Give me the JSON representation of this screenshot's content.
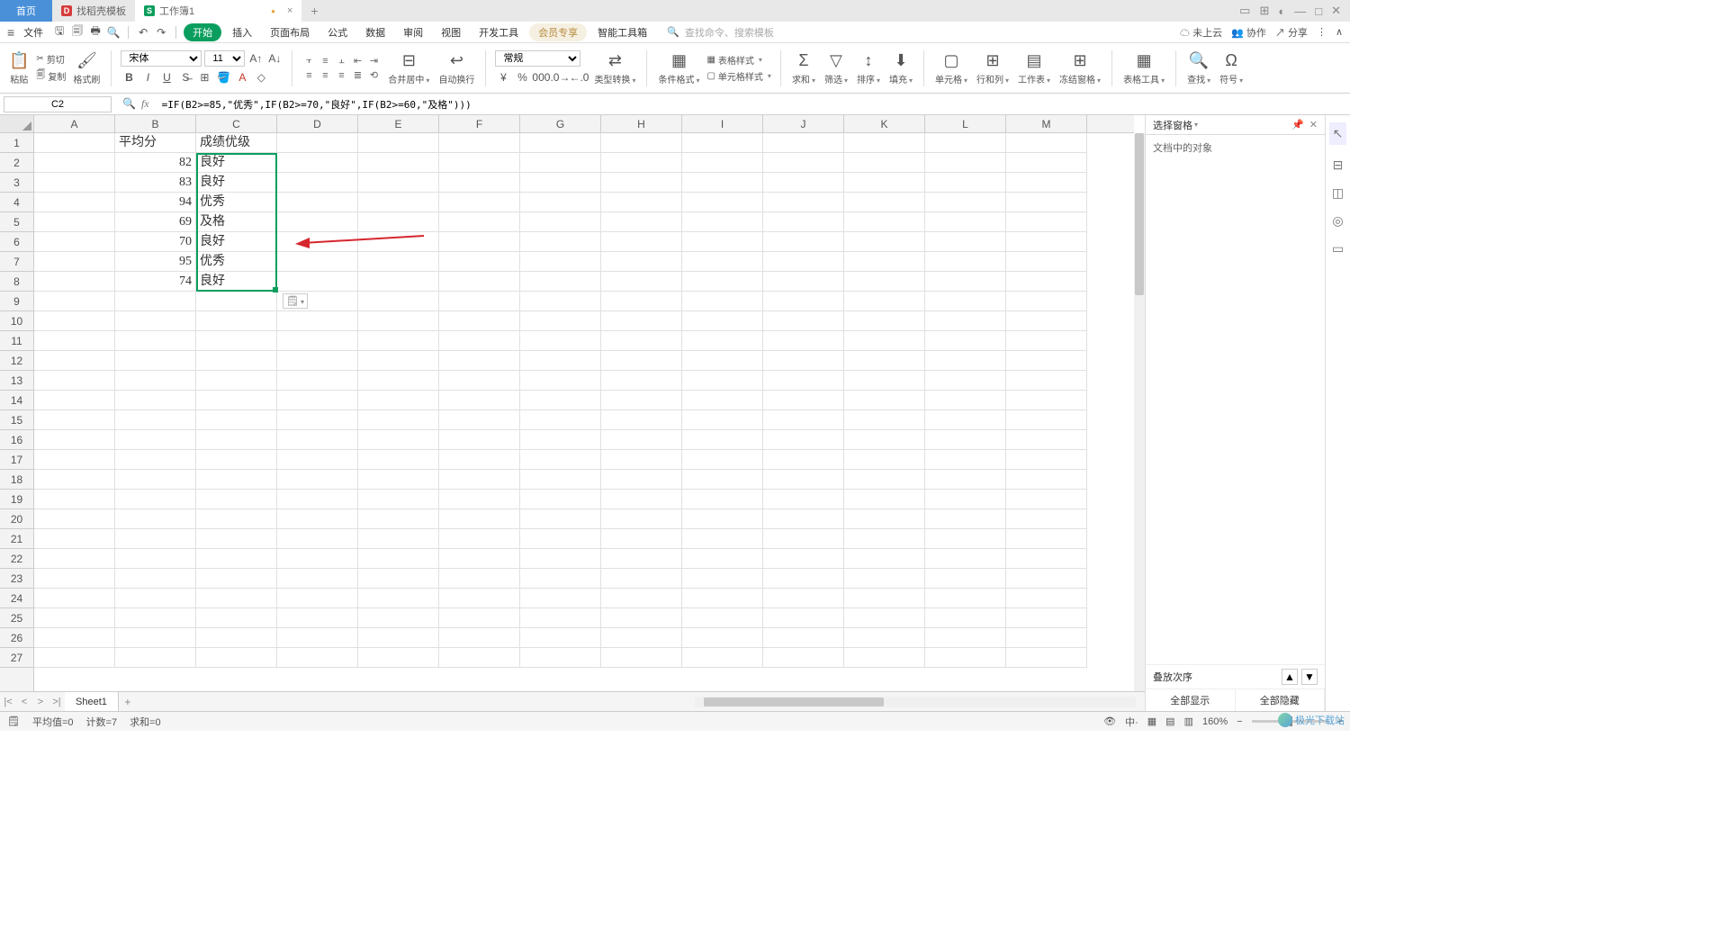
{
  "titlebar": {
    "home": "首页",
    "tab2": "找稻壳模板",
    "tab3": "工作簿1"
  },
  "menubar": {
    "file": "文件",
    "tabs": [
      "开始",
      "插入",
      "页面布局",
      "公式",
      "数据",
      "审阅",
      "视图",
      "开发工具",
      "会员专享",
      "智能工具箱"
    ],
    "search_hint": "查找命令、搜索模板",
    "cloud": "未上云",
    "coop": "协作",
    "share": "分享"
  },
  "ribbon": {
    "paste": "粘贴",
    "cut": "剪切",
    "copy": "复制",
    "fmtpainter": "格式刷",
    "font_name": "宋体",
    "font_size": "11",
    "merge": "合并居中",
    "wrap": "自动换行",
    "num_fmt": "常规",
    "type_conv": "类型转换",
    "cond_fmt": "条件格式",
    "table_style": "表格样式",
    "cell_style": "单元格样式",
    "sum": "求和",
    "filter": "筛选",
    "sort": "排序",
    "fill": "填充",
    "cell": "单元格",
    "rowcol": "行和列",
    "wksheet": "工作表",
    "freeze": "冻结窗格",
    "tools": "表格工具",
    "find": "查找",
    "symbol": "符号"
  },
  "formula": {
    "cell_ref": "C2",
    "text": "=IF(B2>=85,\"优秀\",IF(B2>=70,\"良好\",IF(B2>=60,\"及格\")))"
  },
  "columns": [
    "A",
    "B",
    "C",
    "D",
    "E",
    "F",
    "G",
    "H",
    "I",
    "J",
    "K",
    "L",
    "M"
  ],
  "rows": 27,
  "data": {
    "B1": "平均分",
    "C1": "成绩优级",
    "B2": "82",
    "C2": "良好",
    "B3": "83",
    "C3": "良好",
    "B4": "94",
    "C4": "优秀",
    "B5": "69",
    "C5": "及格",
    "B6": "70",
    "C6": "良好",
    "B7": "95",
    "C7": "优秀",
    "B8": "74",
    "C8": "良好"
  },
  "side": {
    "title": "选择窗格",
    "objects": "文档中的对象",
    "stack": "叠放次序",
    "show_all": "全部显示",
    "hide_all": "全部隐藏"
  },
  "sheet_tab": "Sheet1",
  "status": {
    "avg": "平均值=0",
    "count": "计数=7",
    "sum": "求和=0",
    "zoom": "160%"
  },
  "watermark": "极光下载站"
}
